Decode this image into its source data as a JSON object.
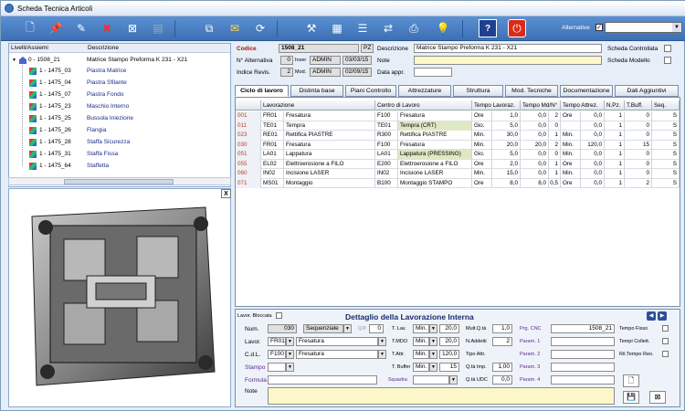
{
  "window": {
    "title": "Scheda Tecnica Articoli"
  },
  "toolbar": {
    "alternative_label": "Alternative",
    "alternative_checked": "✓",
    "icons": [
      "new-icon",
      "pin-icon",
      "edit-icon",
      "delete-icon",
      "close-doc-icon",
      "print-disabled-icon",
      "copy-icon",
      "mail-icon",
      "refresh-icon",
      "tools-icon",
      "calculator-icon",
      "list-icon",
      "transfer-icon",
      "printer-icon",
      "bulb-icon",
      "help-icon",
      "exit-icon"
    ]
  },
  "tree": {
    "col_levels": "Livelli/Assiemi",
    "col_desc": "Descrizione",
    "root": {
      "code": "0 - 1508_21",
      "desc": "Matrice Stampo Preforma K 231 - X21"
    },
    "items": [
      {
        "code": "1 - 1475_03",
        "desc": "Piastra Matrice"
      },
      {
        "code": "1 - 1475_04",
        "desc": "Piastra Sfilante"
      },
      {
        "code": "1 - 1475_07",
        "desc": "Piastra Fondo"
      },
      {
        "code": "1 - 1475_23",
        "desc": "Maschio Interno"
      },
      {
        "code": "1 - 1475_25",
        "desc": "Bussola Iniezione"
      },
      {
        "code": "1 - 1475_26",
        "desc": "Flangia"
      },
      {
        "code": "1 - 1475_28",
        "desc": "Staffa Sicurezza"
      },
      {
        "code": "1 - 1475_31",
        "desc": "Staffa Fissa"
      },
      {
        "code": "1 - 1475_64",
        "desc": "Staffetta"
      }
    ],
    "close_label": "X"
  },
  "header": {
    "codice_label": "Codice",
    "codice": "1508_21",
    "pz": "PZ",
    "descrizione_label": "Descrizione",
    "descrizione": "Matrice Stampo Preforma K 231 - X21",
    "alternativa_label": "N° Alternativa",
    "alternativa": "0",
    "inser_label": "Inser",
    "inser_user": "ADMIN",
    "inser_date": "03/03/15",
    "note_label": "Note",
    "indice_label": "Indice Revis.",
    "indice": "2",
    "mod_label": "Mod.",
    "mod_user": "ADMIN",
    "mod_date": "02/09/15",
    "data_appr_label": "Data appr.",
    "scheda_controllata": "Scheda Controllata",
    "scheda_modello": "Scheda Modello"
  },
  "tabs": [
    "Ciclo di lavoro",
    "Distinta base",
    "Piani Controllo",
    "Attrezzature",
    "Struttura",
    "Mod. Tecniche",
    "Documentazione",
    "Dati Aggiuntivi"
  ],
  "grid": {
    "columns": [
      "",
      "Lavorazione",
      "",
      "Centro di Lavoro",
      "",
      "Tempo Lavoraz.",
      "Tempo Md/N°",
      "Tempo Attrez.",
      "",
      "N.Pz.",
      "T.Buff.",
      "Seq."
    ],
    "rows": [
      [
        "001",
        "FR01",
        "Fresatura",
        "F100",
        "Fresatura",
        "Ore",
        "1,0",
        "0,0",
        "2",
        "Ore",
        "0,0",
        "1",
        "0",
        "S"
      ],
      [
        "011",
        "TE01",
        "Tempra",
        "TE01",
        "Tempra (CRT)",
        "Gio.",
        "5,0",
        "0,0",
        "0",
        "",
        "0,0",
        "1",
        "0",
        "S"
      ],
      [
        "023",
        "RE01",
        "Rettifica PIASTRE",
        "R300",
        "Rettifica PIASTRE",
        "Min.",
        "30,0",
        "0,0",
        "1",
        "Min.",
        "0,0",
        "1",
        "0",
        "S"
      ],
      [
        "030",
        "FR01",
        "Fresatura",
        "F100",
        "Fresatura",
        "Min.",
        "20,0",
        "20,0",
        "2",
        "Min.",
        "120,0",
        "1",
        "15",
        "S"
      ],
      [
        "051",
        "LA01",
        "Lappatura",
        "LA01",
        "Lappatura (PRESSING)",
        "Gio.",
        "5,0",
        "0,0",
        "0",
        "Min.",
        "0,0",
        "1",
        "0",
        "S"
      ],
      [
        "055",
        "EL02",
        "Elettroerosione a FILO",
        "E200",
        "Elettroerosione a FILO",
        "Ore",
        "2,0",
        "0,0",
        "1",
        "Ore",
        "0,0",
        "1",
        "0",
        "S"
      ],
      [
        "060",
        "IN02",
        "Incisione LASER",
        "IN02",
        "Incisione LASER",
        "Min.",
        "15,0",
        "0,0",
        "1",
        "Min.",
        "0,0",
        "1",
        "0",
        "S"
      ],
      [
        "071",
        "MS01",
        "Montaggio",
        "B100",
        "Montaggio STAMPO",
        "Ore",
        "8,0",
        "8,0",
        "0,5",
        "Ore",
        "0,0",
        "1",
        "2",
        "S"
      ]
    ]
  },
  "detail": {
    "lavor_bloccata": "Lavor. Bloccata",
    "title": "Dettaglio della Lavorazione Interna",
    "num_label": "Num.",
    "num": "030",
    "seq": "Sequenziale",
    "qp_label": "Q.P.",
    "qp": "0",
    "tlav_label": "T. Lav.",
    "tlav_unit": "Min.",
    "tlav": "20,0",
    "multq_label": "Mult.Q.tà",
    "multq": "1,0",
    "prgcnc_label": "Prg. CNC",
    "prgcnc": "1508_21",
    "tempo_fisso": "Tempo Fisso",
    "lavor_label": "Lavor.",
    "lavor_code": "FR01",
    "lavor_desc": "Fresatura",
    "tmdo_label": "T.MDO",
    "tmdo_unit": "Min.",
    "tmdo": "20,0",
    "naddetti_label": "N.Addetti",
    "naddetti": "2",
    "param1": "Param. 1",
    "tempi_collettivi": "Tempi Collett.",
    "cdl_label": "C.d.L.",
    "cdl_code": "F100",
    "cdl_desc": "Fresatura",
    "tattr_label": "T.Attr.",
    "tattr_unit": "Min.",
    "tattr": "120,0",
    "tipoattr_label": "Tipo Attr.",
    "param2": "Param. 2",
    "ril_tempo": "Ril.Tempo Reo.",
    "stampo_label": "Stampo",
    "tbuffer_label": "T. Buffer",
    "tbuffer_unit": "Min.",
    "tbuffer": "15",
    "qtaimp_label": "Q.tà Imp.",
    "qtaimp": "1,00",
    "param3": "Param. 3",
    "formula_label": "Formula",
    "squadra_label": "Squadra",
    "qtaudc_label": "Q.tà UDC",
    "qtaudc": "0,0",
    "param4": "Param. 4",
    "note_label": "Note"
  }
}
